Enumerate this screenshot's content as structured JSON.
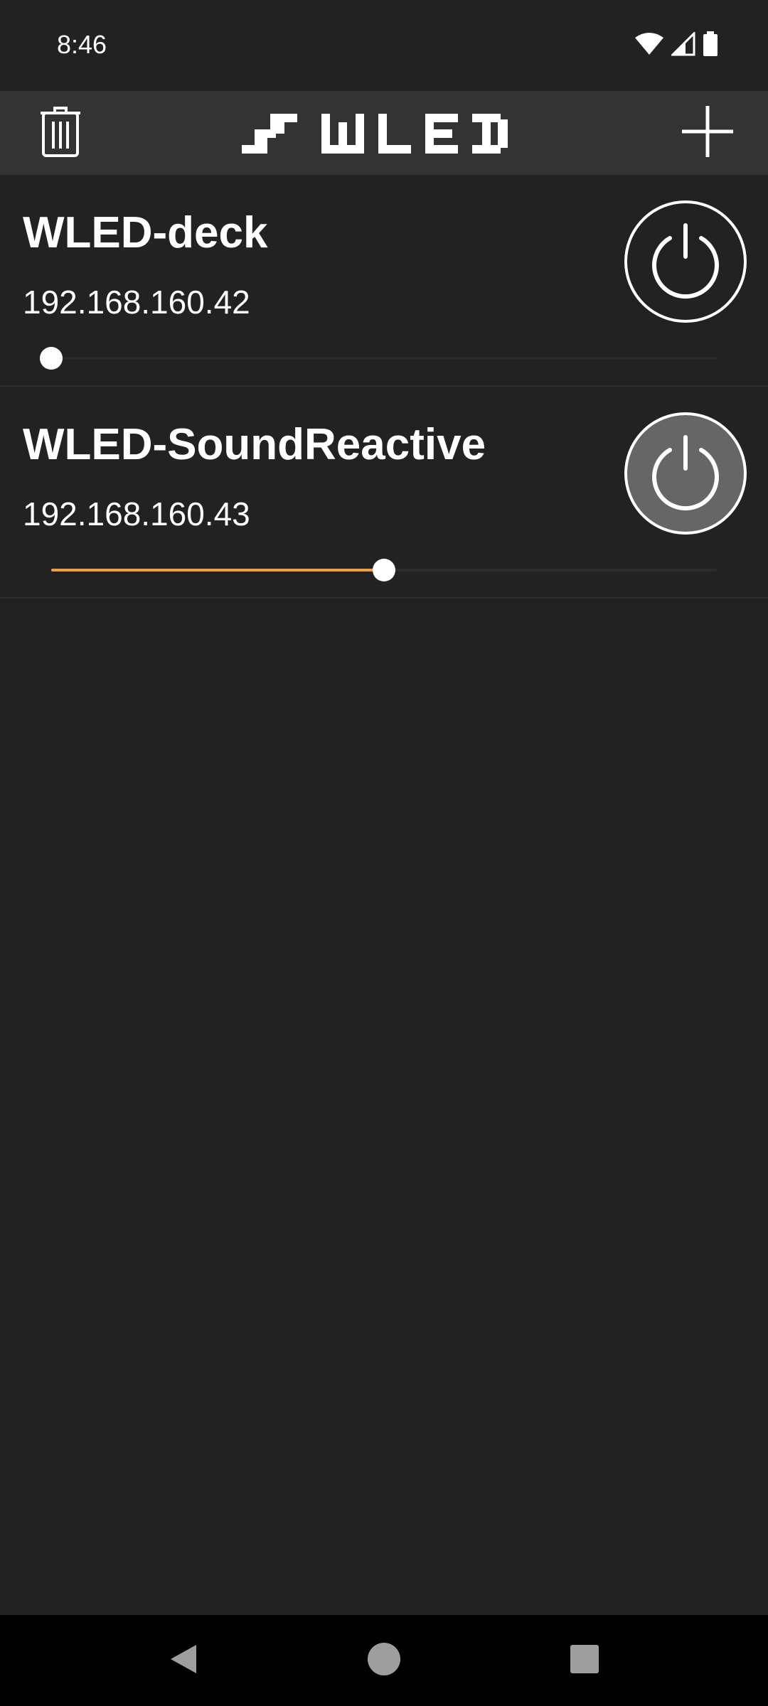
{
  "status_bar": {
    "time": "8:46",
    "icons": [
      "wifi-icon",
      "cell-signal-icon",
      "battery-icon"
    ]
  },
  "app_bar": {
    "title": "WLED",
    "left_icon": "trash-icon",
    "right_icon": "plus-icon"
  },
  "devices": [
    {
      "name": "WLED-deck",
      "ip": "192.168.160.42",
      "on": false,
      "brightness": 0.0
    },
    {
      "name": "WLED-SoundReactive",
      "ip": "192.168.160.43",
      "on": true,
      "brightness": 0.5
    }
  ],
  "colors": {
    "background": "#222222",
    "app_bar": "#333333",
    "accent": "#f0a040",
    "power_on_fill": "#666666"
  },
  "nav_bar": {
    "buttons": [
      "back-icon",
      "home-icon",
      "recents-icon"
    ]
  }
}
